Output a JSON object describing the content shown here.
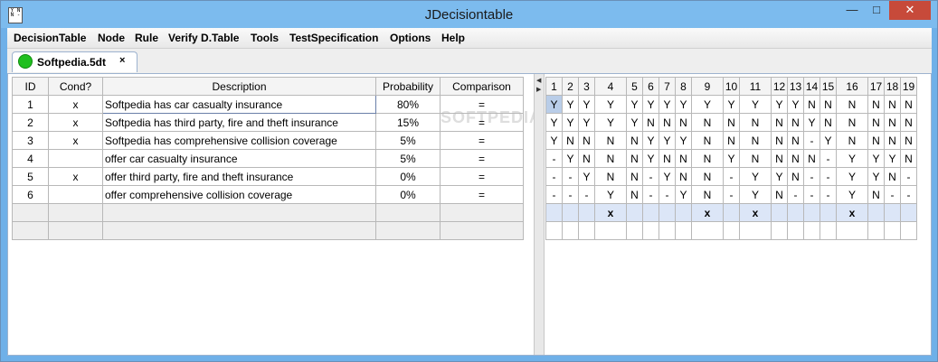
{
  "window": {
    "title": "JDecisiontable",
    "icon_text": "YN N-"
  },
  "menu": [
    "DecisionTable",
    "Node",
    "Rule",
    "Verify D.Table",
    "Tools",
    "TestSpecification",
    "Options",
    "Help"
  ],
  "tab": {
    "label": "Softpedia.5dt",
    "close": "×"
  },
  "left_table": {
    "headers": [
      "ID",
      "Cond?",
      "Description",
      "Probability",
      "Comparison"
    ],
    "rows": [
      [
        "1",
        "x",
        "Softpedia has car casualty insurance",
        "80%",
        "="
      ],
      [
        "2",
        "x",
        "Softpedia has third party, fire and theft insurance",
        "15%",
        "="
      ],
      [
        "3",
        "x",
        "Softpedia has comprehensive collision coverage",
        "5%",
        "="
      ],
      [
        "4",
        "",
        "offer car casualty insurance",
        "5%",
        "="
      ],
      [
        "5",
        "x",
        "offer third party, fire and theft insurance",
        "0%",
        "="
      ],
      [
        "6",
        "",
        "offer comprehensive collision coverage",
        "0%",
        "="
      ]
    ]
  },
  "right_table": {
    "headers": [
      "1",
      "2",
      "3",
      "4",
      "5",
      "6",
      "7",
      "8",
      "9",
      "10",
      "11",
      "12",
      "13",
      "14",
      "15",
      "16",
      "17",
      "18",
      "19"
    ],
    "rows": [
      [
        "Y",
        "Y",
        "Y",
        "Y",
        "Y",
        "Y",
        "Y",
        "Y",
        "Y",
        "Y",
        "Y",
        "Y",
        "Y",
        "N",
        "N",
        "N",
        "N",
        "N",
        "N"
      ],
      [
        "Y",
        "Y",
        "Y",
        "Y",
        "Y",
        "N",
        "N",
        "N",
        "N",
        "N",
        "N",
        "N",
        "N",
        "Y",
        "N",
        "N",
        "N",
        "N",
        "N"
      ],
      [
        "Y",
        "N",
        "N",
        "N",
        "N",
        "Y",
        "Y",
        "Y",
        "N",
        "N",
        "N",
        "N",
        "N",
        "-",
        "Y",
        "N",
        "N",
        "N",
        "N"
      ],
      [
        "-",
        "Y",
        "N",
        "N",
        "N",
        "Y",
        "N",
        "N",
        "N",
        "Y",
        "N",
        "N",
        "N",
        "N",
        "-",
        "Y",
        "Y",
        "Y",
        "N"
      ],
      [
        "-",
        "-",
        "Y",
        "N",
        "N",
        "-",
        "Y",
        "N",
        "N",
        "-",
        "Y",
        "Y",
        "N",
        "-",
        "-",
        "Y",
        "Y",
        "N",
        "-"
      ],
      [
        "-",
        "-",
        "-",
        "Y",
        "N",
        "-",
        "-",
        "Y",
        "N",
        "-",
        "Y",
        "N",
        "-",
        "-",
        "-",
        "Y",
        "N",
        "-",
        "-"
      ]
    ],
    "action_row": [
      "",
      "",
      "",
      "x",
      "",
      "",
      "",
      "",
      "x",
      "",
      "x",
      "",
      "",
      "",
      "",
      "x",
      "",
      "",
      ""
    ]
  },
  "watermark": "SOFTPEDIA"
}
